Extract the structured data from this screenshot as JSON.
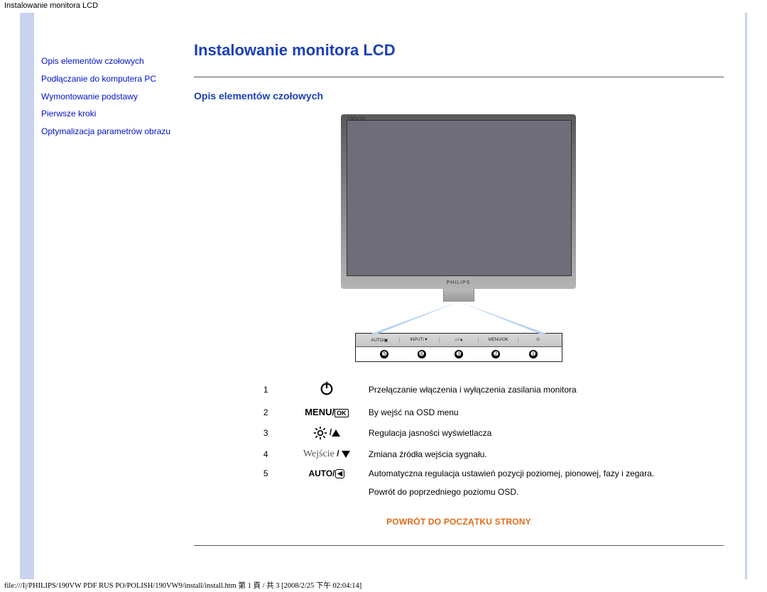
{
  "doc_title": "Instalowanie monitora LCD",
  "sidebar": {
    "items": [
      {
        "label": "Opis elementów czołowych"
      },
      {
        "label": "Podłączanie do komputera PC"
      },
      {
        "label": "Wymontowanie podstawy"
      },
      {
        "label": "Pierwsze kroki"
      },
      {
        "label": "Optymalizacja parametrów obrazu"
      }
    ]
  },
  "content": {
    "h1": "Instalowanie monitora LCD",
    "h2": "Opis elementów czołowych",
    "monitor_model": "190VW",
    "monitor_logo": "PHILIPS",
    "panel_labels": [
      "AUTO/▣",
      "INPUT/▼",
      "☼/▲",
      "MENU/OK",
      "⏻"
    ],
    "panel_numbers": [
      "➎",
      "➍",
      "➌",
      "➋",
      "➊"
    ],
    "rows": [
      {
        "n": "1",
        "desc": "Przełączanie włączenia i wyłączenia zasilania monitora"
      },
      {
        "n": "2",
        "desc": "By wejść na OSD menu"
      },
      {
        "n": "3",
        "desc": "Regulacja jasności wyświetlacza"
      },
      {
        "n": "4",
        "desc": "Zmiana źródła wejścia sygnału."
      },
      {
        "n": "5",
        "desc": "Automatyczna regulacja ustawień pozycji poziomej, pionowej, fazy i zegara."
      }
    ],
    "row5_extra": "Powrót do poprzedniego poziomu OSD.",
    "icon_menu_text": "MENU",
    "icon_ok_text": "OK",
    "icon_input_text": "Wejście",
    "icon_auto_text": "AUTO",
    "return_link": "POWRÓT DO POCZĄTKU STRONY"
  },
  "footer": "file:///I|/PHILIPS/190VW PDF RUS PO/POLISH/190VW9/install/install.htm 第 1 頁 / 共 3  [2008/2/25 下午 02:04:14]"
}
